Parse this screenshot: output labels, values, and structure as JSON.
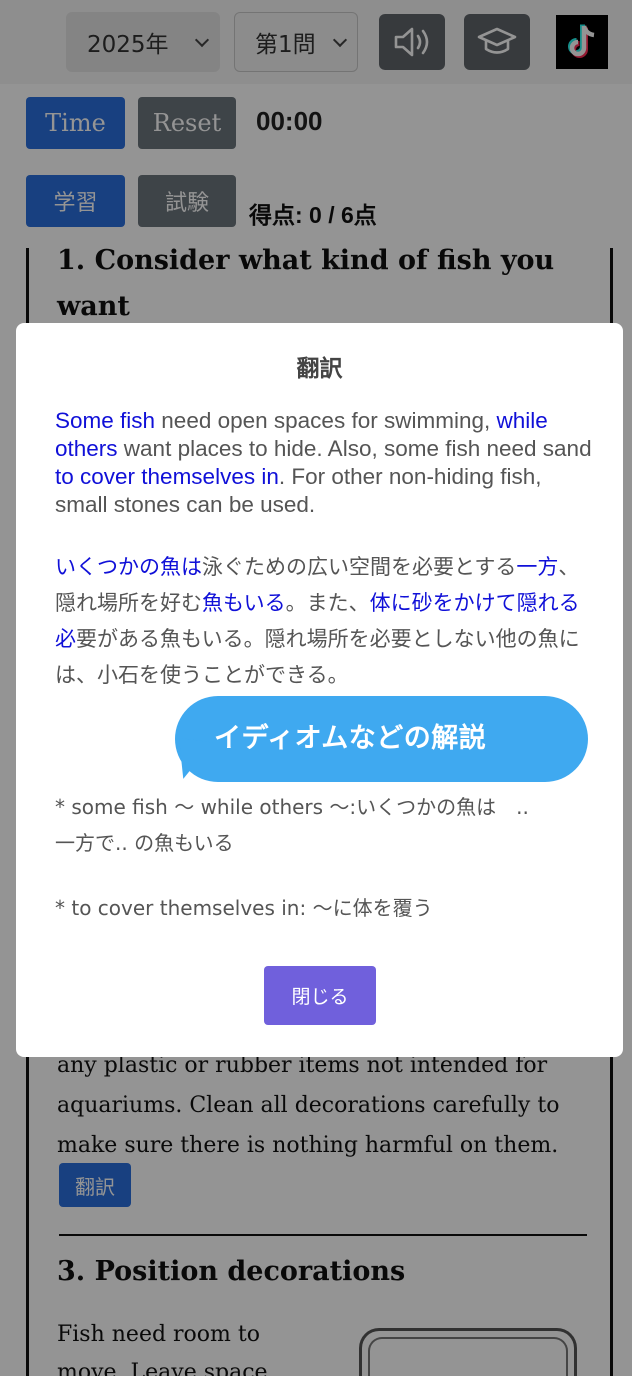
{
  "header": {
    "year_select": "2025年",
    "question_select": "第1問",
    "sound_icon": "speaker-icon",
    "study_icon": "graduation-cap-icon",
    "tiktok_icon": "tiktok-logo"
  },
  "controls": {
    "time_label": "Time",
    "reset_label": "Reset",
    "timer": "00:00",
    "study_label": "学習",
    "exam_label": "試験",
    "score": "得点: 0 / 6点"
  },
  "article": {
    "heading1": "1. Consider what kind of fish you want",
    "paragraph2": "any plastic or rubber items not intended for aquariums. Clean all decorations carefully to make sure there is nothing harmful on them.",
    "translate_label": "翻訳",
    "heading3": "3. Position decorations",
    "paragraph3": "Fish need room to move. Leave space"
  },
  "modal": {
    "title": "翻訳",
    "english": {
      "p1_hl": "Some fish",
      "p1_a": " need open spaces for swimming, ",
      "p1_hl2": "while others",
      "p1_b": " want places to hide. Also, some fish need sand ",
      "p1_hl3": "to cover themselves in",
      "p1_c": ". For other non-hiding fish, small stones can be used."
    },
    "japanese": {
      "hl1": "いくつかの魚は",
      "t1": "泳ぐための広い空間を必要とする",
      "hl2": "一方",
      "t2": "、隠れ場所を好む",
      "hl3": "魚もいる",
      "t3": "。また、",
      "hl4": "体に砂をかけて隠れる必",
      "t4": "要がある魚もいる。隠れ場所を必要としない他の魚には、小石を使うことができる。"
    },
    "note1": "* some fish 〜 while others 〜:いくつかの魚は　.. 一方で.. の魚もいる",
    "note2": "* to cover themselves in: 〜に体を覆う",
    "close_label": "閉じる"
  },
  "callout": {
    "text": "イディオムなどの解説"
  },
  "colors": {
    "primary": "#2a6fdc",
    "secondary": "#6c757d",
    "highlight": "#1010d8",
    "close_button": "#7060dc",
    "callout": "#3fa9f0"
  }
}
